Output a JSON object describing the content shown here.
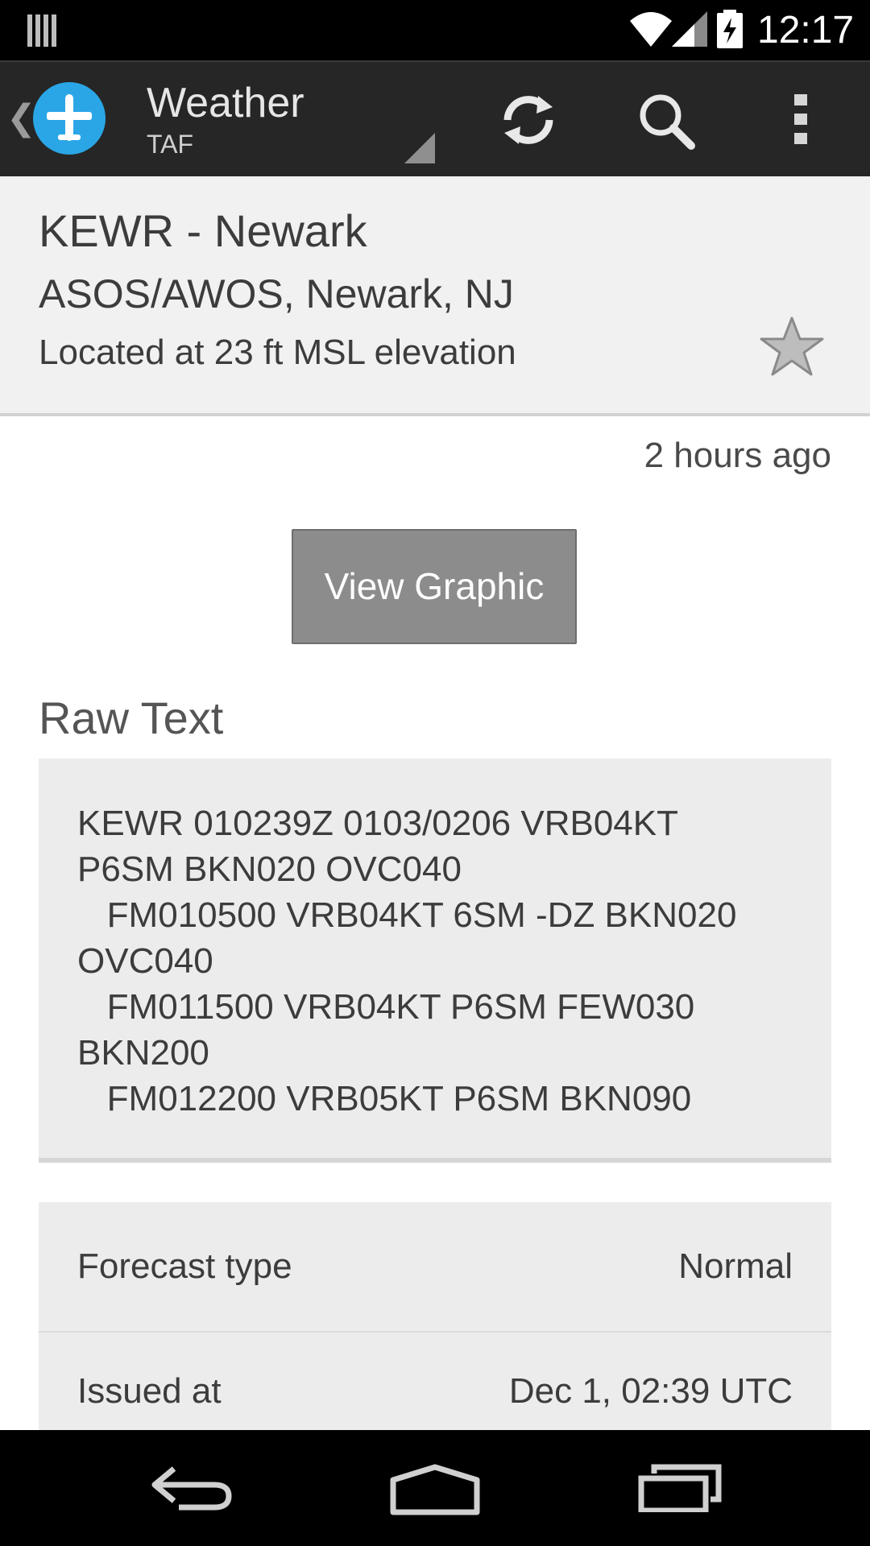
{
  "status_bar": {
    "time": "12:17",
    "icons": [
      "barcode-icon",
      "wifi-icon",
      "signal-icon",
      "battery-charging-icon"
    ]
  },
  "action_bar": {
    "title": "Weather",
    "subtitle": "TAF",
    "icons": [
      "back-chevron-icon",
      "airplane-logo-icon",
      "spinner-triangle-icon",
      "refresh-icon",
      "search-icon",
      "overflow-menu-icon"
    ]
  },
  "airport": {
    "name": "KEWR - Newark",
    "station_type": "ASOS/AWOS, Newark, NJ",
    "elevation": "Located at 23 ft MSL elevation",
    "favorite_icon": "star-icon"
  },
  "updated": "2 hours ago",
  "view_graphic_label": "View Graphic",
  "raw_text": {
    "heading": "Raw Text",
    "lines": [
      "KEWR 010239Z 0103/0206 VRB04KT",
      "P6SM BKN020 OVC040",
      "   FM010500 VRB04KT 6SM -DZ BKN020",
      "OVC040",
      "   FM011500 VRB04KT P6SM FEW030",
      "BKN200",
      "   FM012200 VRB05KT P6SM BKN090"
    ]
  },
  "details": [
    {
      "label": "Forecast type",
      "value": "Normal"
    },
    {
      "label": "Issued at",
      "value": "Dec 1, 02:39 UTC"
    }
  ],
  "nav_bar": {
    "icons": [
      "back-icon",
      "home-icon",
      "recents-icon"
    ]
  },
  "colors": {
    "action_bar": "#262626",
    "header_bg": "#f1f1f1",
    "button_bg": "#8c8c8c",
    "panel_bg": "#ececec",
    "logo_blue": "#2aa6e6"
  }
}
